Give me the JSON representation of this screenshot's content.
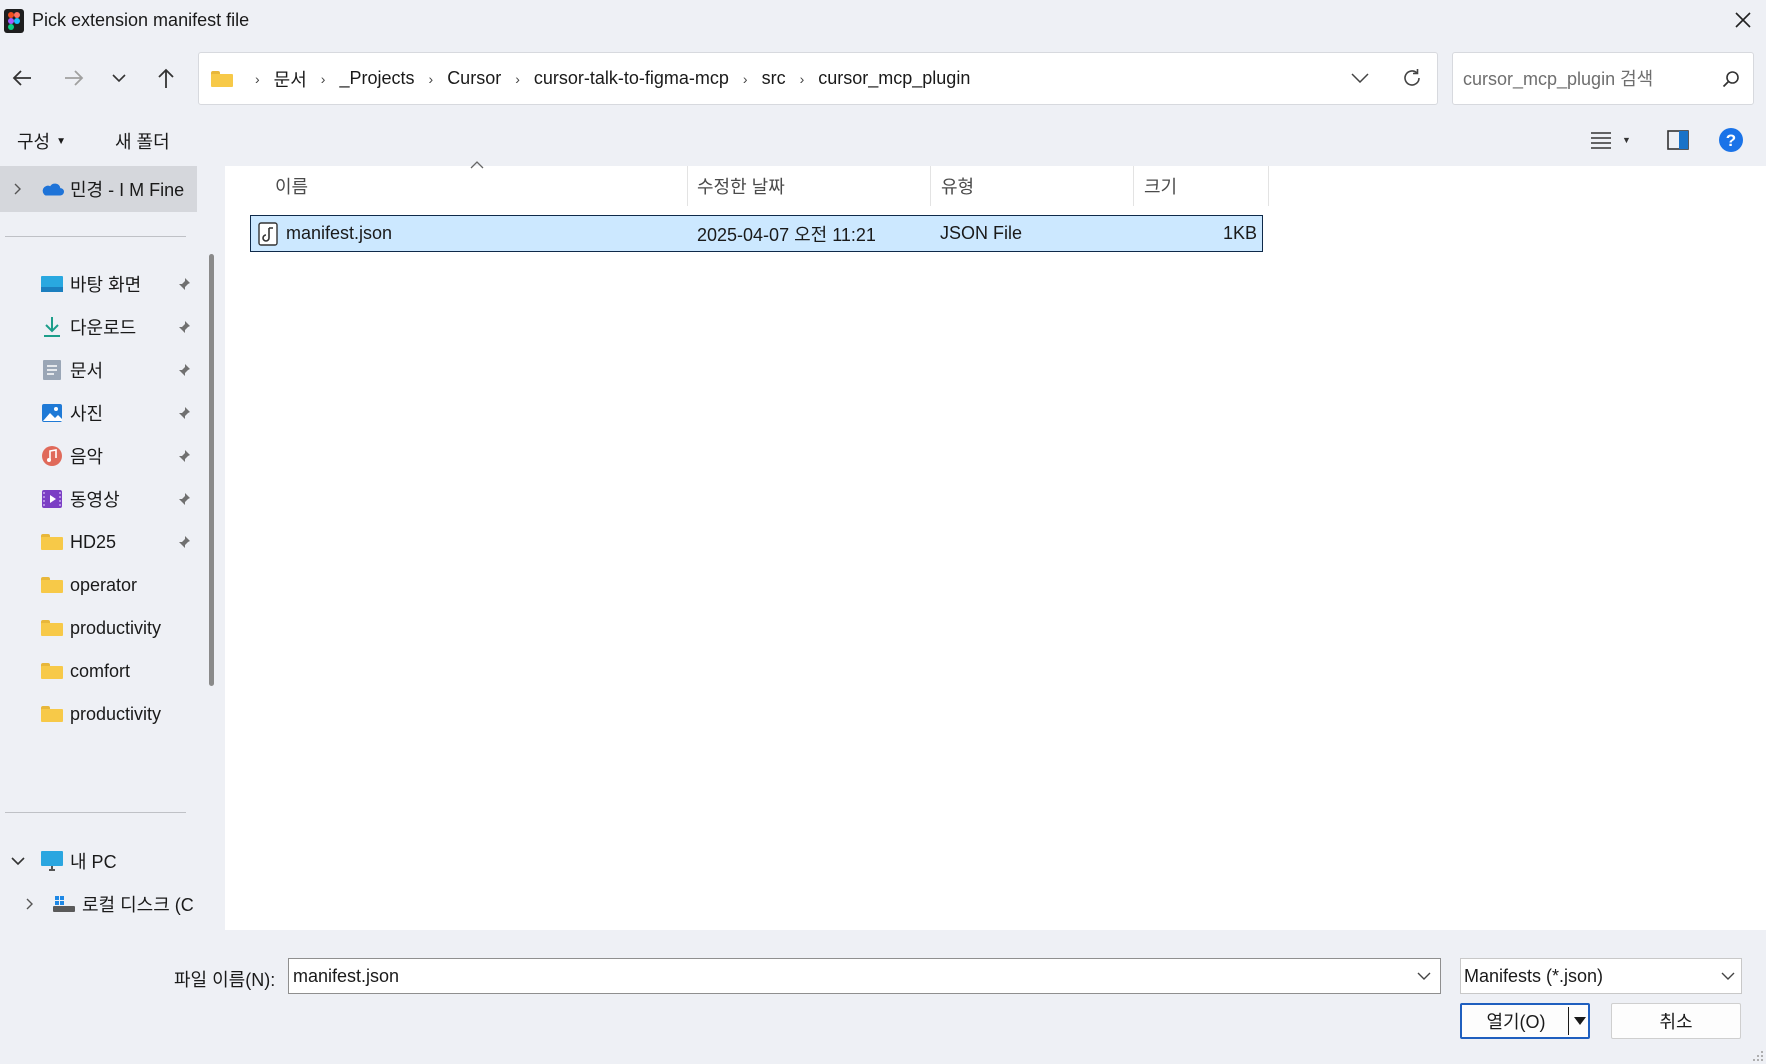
{
  "window": {
    "title": "Pick extension manifest file"
  },
  "address": {
    "crumbs": [
      "문서",
      "_Projects",
      "Cursor",
      "cursor-talk-to-figma-mcp",
      "src",
      "cursor_mcp_plugin"
    ]
  },
  "search": {
    "placeholder": "cursor_mcp_plugin 검색"
  },
  "commands": {
    "organize": "구성",
    "new_folder": "새 폴더"
  },
  "sidebar": {
    "onedrive": "민경 - I M Fine",
    "quick": [
      {
        "label": "바탕 화면",
        "icon": "desktop-icon"
      },
      {
        "label": "다운로드",
        "icon": "download-icon"
      },
      {
        "label": "문서",
        "icon": "documents-icon"
      },
      {
        "label": "사진",
        "icon": "pictures-icon"
      },
      {
        "label": "음악",
        "icon": "music-icon"
      },
      {
        "label": "동영상",
        "icon": "videos-icon"
      },
      {
        "label": "HD25",
        "icon": "folder-icon"
      }
    ],
    "folders": [
      "operator",
      "productivity",
      "comfort",
      "productivity"
    ],
    "this_pc": "내 PC",
    "local_disk": "로컬 디스크 (C"
  },
  "columns": {
    "name": "이름",
    "modified": "수정한 날짜",
    "type": "유형",
    "size": "크기"
  },
  "files": [
    {
      "name": "manifest.json",
      "modified": "2025-04-07 오전 11:21",
      "type": "JSON File",
      "size": "1KB"
    }
  ],
  "bottom": {
    "filename_label": "파일 이름(N):",
    "filename_value": "manifest.json",
    "filetype": "Manifests (*.json)",
    "open": "열기(O)",
    "cancel": "취소"
  },
  "colors": {
    "accent": "#1f5fbf",
    "selection": "#cce8ff",
    "chrome": "#eef0f5"
  }
}
